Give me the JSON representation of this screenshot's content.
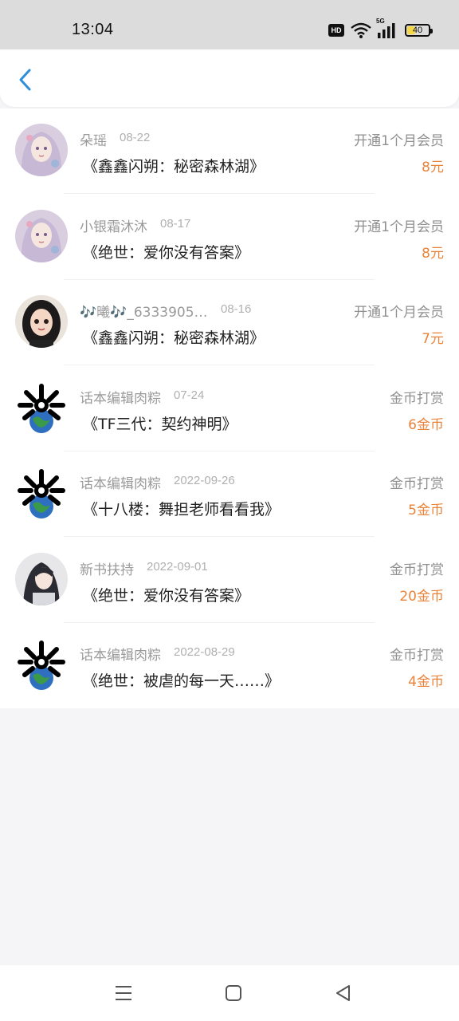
{
  "status_bar": {
    "time": "13:04",
    "hd_label": "HD",
    "network_label": "5G",
    "battery_level": "40",
    "battery_fraction": 0.4
  },
  "header": {
    "back_icon": "chevron-left-icon",
    "accent_color": "#2e8fd8"
  },
  "records": [
    {
      "user": "朵瑶",
      "date": "08-22",
      "title": "《鑫鑫闪朔：秘密森林湖》",
      "type": "开通1个月会员",
      "amount": "8元",
      "avatar": "anime-girl-avatar"
    },
    {
      "user": "小银霜沐沐",
      "date": "08-17",
      "title": "《绝世：爱你没有答案》",
      "type": "开通1个月会员",
      "amount": "8元",
      "avatar": "anime-girl-avatar"
    },
    {
      "user": "🎶曦🎶_6333905…",
      "date": "08-16",
      "title": "《鑫鑫闪朔：秘密森林湖》",
      "type": "开通1个月会员",
      "amount": "7元",
      "avatar": "cartoon-girl-avatar"
    },
    {
      "user": "话本编辑肉粽",
      "date": "07-24",
      "title": "《TF三代：契约神明》",
      "type": "金币打赏",
      "amount": "6金币",
      "avatar": "earth-logo-avatar"
    },
    {
      "user": "话本编辑肉粽",
      "date": "2022-09-26",
      "title": "《十八楼：舞担老师看看我》",
      "type": "金币打赏",
      "amount": "5金币",
      "avatar": "earth-logo-avatar"
    },
    {
      "user": "新书扶持",
      "date": "2022-09-01",
      "title": "《绝世：爱你没有答案》",
      "type": "金币打赏",
      "amount": "20金币",
      "avatar": "anime-boy-avatar"
    },
    {
      "user": "话本编辑肉粽",
      "date": "2022-08-29",
      "title": "《绝世：被虐的每一天……》",
      "type": "金币打赏",
      "amount": "4金币",
      "avatar": "earth-logo-avatar"
    }
  ],
  "colors": {
    "amount": "#e9833a",
    "meta_text": "#9a9a9a",
    "title_text": "#222222",
    "page_background": "#f5f4f6"
  },
  "nav_bar": {
    "menu_icon": "menu-icon",
    "home_icon": "home-square-icon",
    "back_icon": "back-triangle-icon"
  }
}
